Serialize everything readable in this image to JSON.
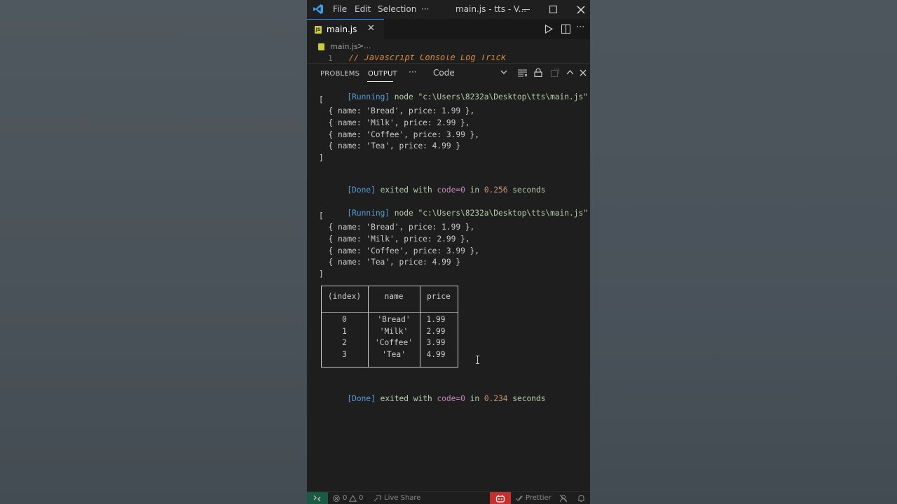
{
  "titlebar": {
    "menu": [
      "File",
      "Edit",
      "Selection",
      "···"
    ],
    "title": "main.js - tts - V...",
    "minimize": "—",
    "maximize": "☐",
    "close": "✕"
  },
  "tabs": {
    "active_label": "main.js",
    "close_glyph": "✕",
    "run_icon": "run-icon",
    "split_icon": "split-editor-icon",
    "more_glyph": "···"
  },
  "breadcrumb": {
    "file": "main.js",
    "sep": ">",
    "rest": "..."
  },
  "editor": {
    "line_number": "1",
    "comment": "// Javascript Console Log Trick"
  },
  "panel": {
    "tabs": [
      "PROBLEMS",
      "OUTPUT"
    ],
    "active_tab": "OUTPUT",
    "more": "···",
    "channel": "Code"
  },
  "output": {
    "running1": {
      "tag": "[Running]",
      "cmd": "node \"c:\\Users\\8232a\\Desktop\\tts\\main.js\""
    },
    "array_open": "[",
    "array_close": "]",
    "items": [
      "  { name: 'Bread', price: 1.99 },",
      "  { name: 'Milk', price: 2.99 },",
      "  { name: 'Coffee', price: 3.99 },",
      "  { name: 'Tea', price: 4.99 }"
    ],
    "done1": {
      "tag": "[Done]",
      "exited": "exited with",
      "code": "code=0",
      "in": "in",
      "secs": "0.256",
      "unit": "seconds"
    },
    "running2": {
      "tag": "[Running]",
      "cmd": "node \"c:\\Users\\8232a\\Desktop\\tts\\main.js\""
    },
    "done2": {
      "tag": "[Done]",
      "exited": "exited with",
      "code": "code=0",
      "in": "in",
      "secs": "0.234",
      "unit": "seconds"
    },
    "table": {
      "headers": [
        "(index)",
        "name",
        "price"
      ],
      "rows": [
        [
          "0",
          "'Bread'",
          "1.99"
        ],
        [
          "1",
          "'Milk'",
          "2.99"
        ],
        [
          "2",
          "'Coffee'",
          "3.99"
        ],
        [
          "3",
          "'Tea'",
          "4.99"
        ]
      ]
    }
  },
  "statusbar": {
    "errors": "0",
    "warnings": "0",
    "live_share": "Live Share",
    "prettier": "Prettier"
  },
  "colors": {
    "accent": "#3794ff",
    "running_tag": "#569cd6",
    "cmd": "#b5cea8",
    "code": "#c586c0",
    "time": "#ce9178",
    "remote": "#16825d",
    "copilot": "#c72e2e"
  }
}
